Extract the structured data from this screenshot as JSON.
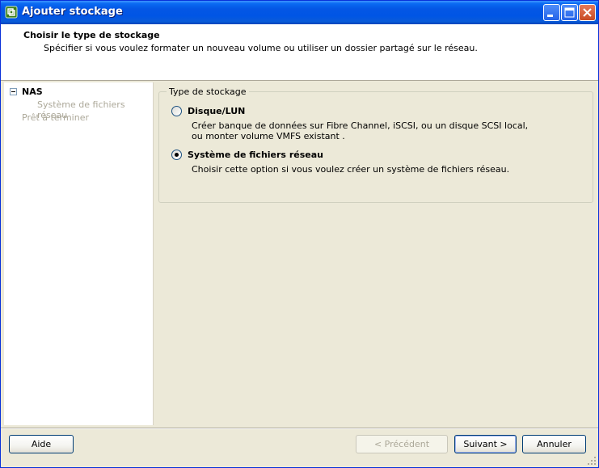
{
  "window": {
    "title": "Ajouter stockage"
  },
  "header": {
    "title": "Choisir le type de stockage",
    "subtitle": "Spécifier si vous voulez formater un nouveau volume ou utiliser un dossier partagé sur le réseau."
  },
  "nav": {
    "items": [
      {
        "label": "NAS"
      },
      {
        "label": "Système de fichiers réseau"
      },
      {
        "label": "Prêt à terminer"
      }
    ]
  },
  "storage_type": {
    "legend": "Type de stockage",
    "options": [
      {
        "label": "Disque/LUN",
        "description_lines": [
          "Créer banque de données sur Fibre Channel, iSCSI, ou un disque SCSI local,",
          "ou monter volume VMFS existant ."
        ],
        "selected": false
      },
      {
        "label": "Système de fichiers réseau",
        "description_lines": [
          "Choisir cette option si vous voulez créer un système de fichiers réseau."
        ],
        "selected": true
      }
    ]
  },
  "buttons": {
    "help": "Aide",
    "previous": "< Précédent",
    "next": "Suivant >",
    "cancel": "Annuler"
  },
  "colors": {
    "titlebar": "#0055e5",
    "dialog_bg": "#ece9d8",
    "disabled_text": "#aca899"
  }
}
